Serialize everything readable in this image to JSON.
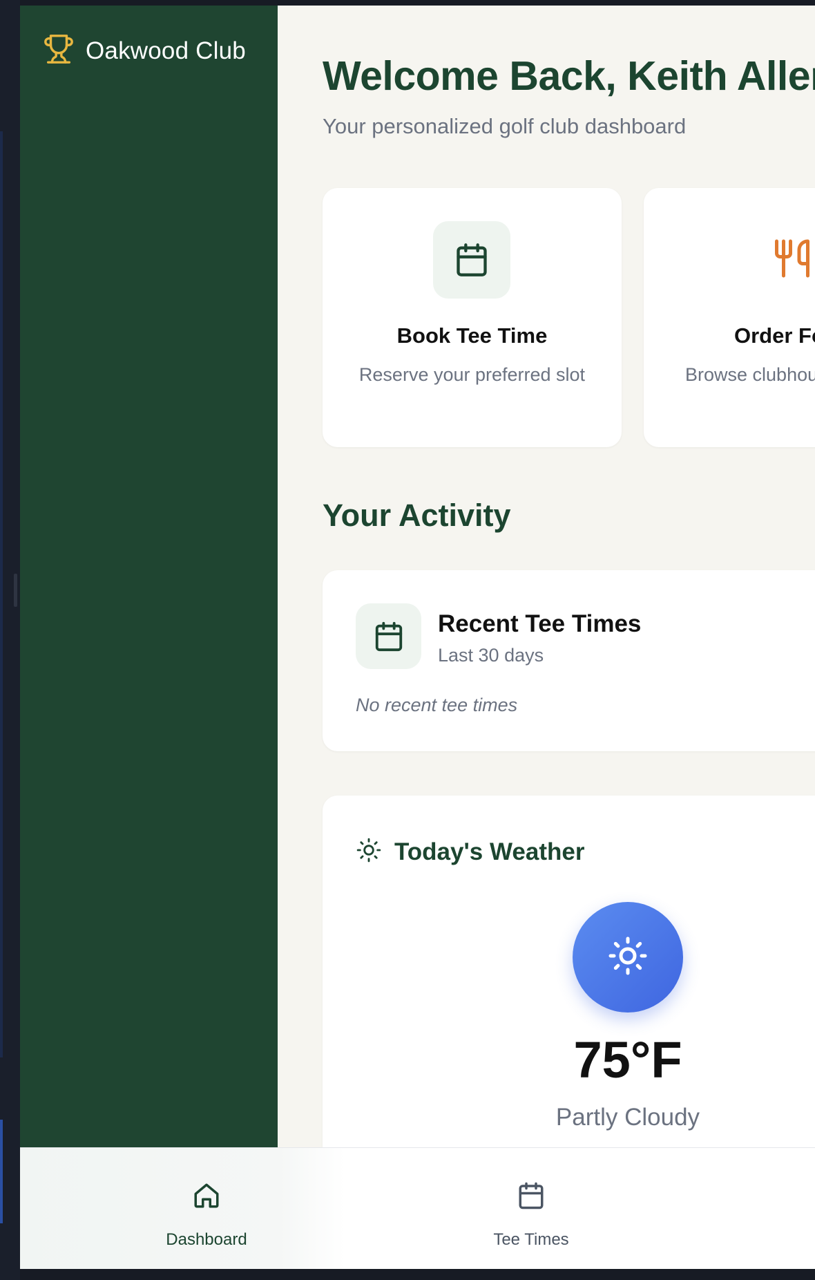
{
  "brand": {
    "name": "Oakwood Club",
    "icon": "trophy-icon",
    "accent": "#e8b740"
  },
  "colors": {
    "sidebar": "#1f4531",
    "primary_text": "#1c4530",
    "background": "#f6f5f0",
    "weather_orb": "#4a77e8",
    "order_icon": "#e07a2f"
  },
  "header": {
    "welcome": "Welcome Back, Keith Allen",
    "subtitle": "Your personalized golf club dashboard"
  },
  "quick_actions": [
    {
      "title": "Book Tee Time",
      "description": "Reserve your preferred slot",
      "icon": "calendar-icon"
    },
    {
      "title": "Order Food",
      "description": "Browse clubhouse menu",
      "icon": "utensils-icon"
    }
  ],
  "activity": {
    "section_title": "Your Activity",
    "recent_tee_times": {
      "title": "Recent Tee Times",
      "subtitle": "Last 30 days",
      "empty": "No recent tee times",
      "icon": "calendar-icon"
    }
  },
  "weather": {
    "title": "Today's Weather",
    "temperature": "75°F",
    "condition": "Partly Cloudy",
    "icon": "sun-icon"
  },
  "bottom_nav": [
    {
      "label": "Dashboard",
      "icon": "home-icon",
      "active": true
    },
    {
      "label": "Tee Times",
      "icon": "calendar-icon",
      "active": false
    }
  ]
}
